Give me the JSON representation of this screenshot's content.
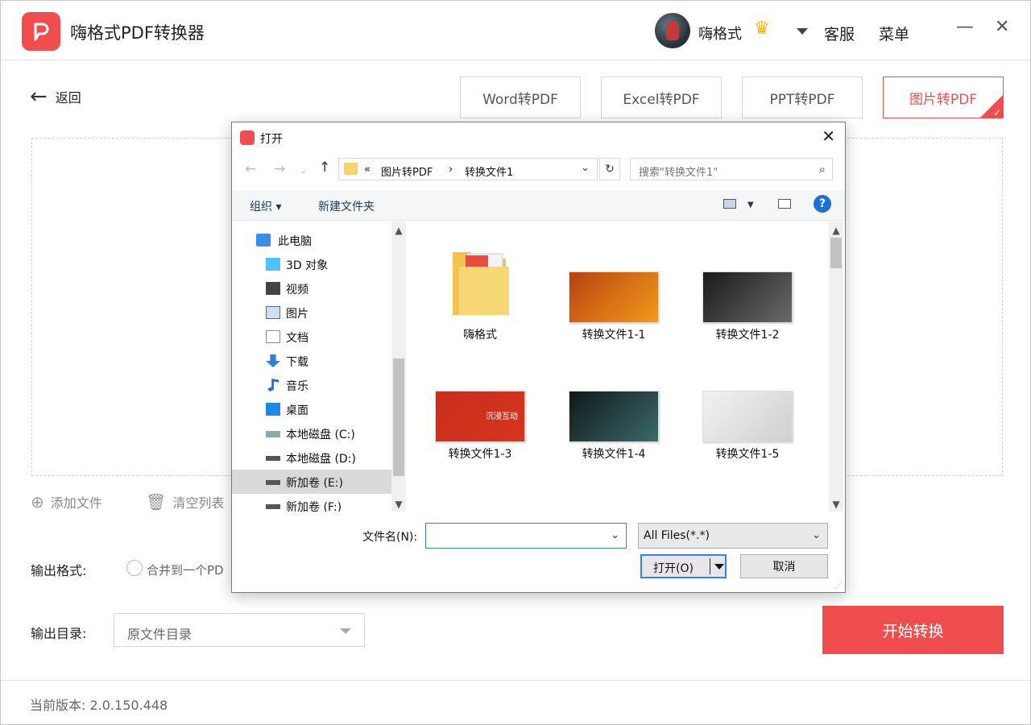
{
  "app": {
    "title": "嗨格式PDF转换器",
    "user_name": "嗨格式",
    "service_label": "客服",
    "menu_label": "菜单",
    "minimize_glyph": "—",
    "close_glyph": "✕",
    "accent_color": "#f04e4e"
  },
  "toolbar": {
    "back_label": "返回",
    "tabs": [
      {
        "label": "Word转PDF",
        "active": false
      },
      {
        "label": "Excel转PDF",
        "active": false
      },
      {
        "label": "PPT转PDF",
        "active": false
      },
      {
        "label": "图片转PDF",
        "active": true
      }
    ]
  },
  "actions": {
    "add_files": "添加文件",
    "clear_list": "清空列表"
  },
  "output": {
    "format_label": "输出格式:",
    "merge_option": "合并到一个PD",
    "dir_label": "输出目录:",
    "dir_value": "原文件目录",
    "start_button": "开始转换"
  },
  "footer": {
    "version_text": "当前版本: 2.0.150.448"
  },
  "dialog": {
    "title": "打开",
    "breadcrumb": {
      "prefix": "«",
      "items": [
        "图片转PDF",
        "转换文件1"
      ],
      "separator": "›"
    },
    "search_placeholder": "搜索\"转换文件1\"",
    "organize_label": "组织 ▾",
    "new_folder_label": "新建文件夹",
    "tree": [
      {
        "label": "此电脑",
        "icon": "computer-icon",
        "selected": false
      },
      {
        "label": "3D 对象",
        "icon": "cube-3d-icon",
        "selected": false
      },
      {
        "label": "视频",
        "icon": "video-icon",
        "selected": false
      },
      {
        "label": "图片",
        "icon": "picture-icon",
        "selected": false
      },
      {
        "label": "文档",
        "icon": "document-icon",
        "selected": false
      },
      {
        "label": "下载",
        "icon": "download-icon",
        "selected": false
      },
      {
        "label": "音乐",
        "icon": "music-icon",
        "selected": false
      },
      {
        "label": "桌面",
        "icon": "desktop-icon",
        "selected": false
      },
      {
        "label": "本地磁盘 (C:)",
        "icon": "drive-c-icon",
        "selected": false
      },
      {
        "label": "本地磁盘 (D:)",
        "icon": "drive-icon",
        "selected": false
      },
      {
        "label": "新加卷 (E:)",
        "icon": "drive-icon",
        "selected": true
      },
      {
        "label": "新加卷 (F:)",
        "icon": "drive-icon",
        "selected": false
      }
    ],
    "files": [
      {
        "label": "嗨格式",
        "kind": "folder"
      },
      {
        "label": "转换文件1-1",
        "kind": "image",
        "colors": [
          "#b8420f",
          "#f29b1c"
        ]
      },
      {
        "label": "转换文件1-2",
        "kind": "image",
        "colors": [
          "#1a1a1a",
          "#6a6a6a"
        ]
      },
      {
        "label": "转换文件1-3",
        "kind": "image",
        "colors": [
          "#c92d1a",
          "#d6351f"
        ],
        "overlay_text": "沉浸互动"
      },
      {
        "label": "转换文件1-4",
        "kind": "image",
        "colors": [
          "#101818",
          "#3c6a6a"
        ]
      },
      {
        "label": "转换文件1-5",
        "kind": "image",
        "colors": [
          "#f2f2f2",
          "#cfcfcf"
        ]
      }
    ],
    "filename_label": "文件名(N):",
    "filename_value": "",
    "filetype_value": "All Files(*.*)",
    "open_button": "打开(O)",
    "cancel_button": "取消"
  }
}
